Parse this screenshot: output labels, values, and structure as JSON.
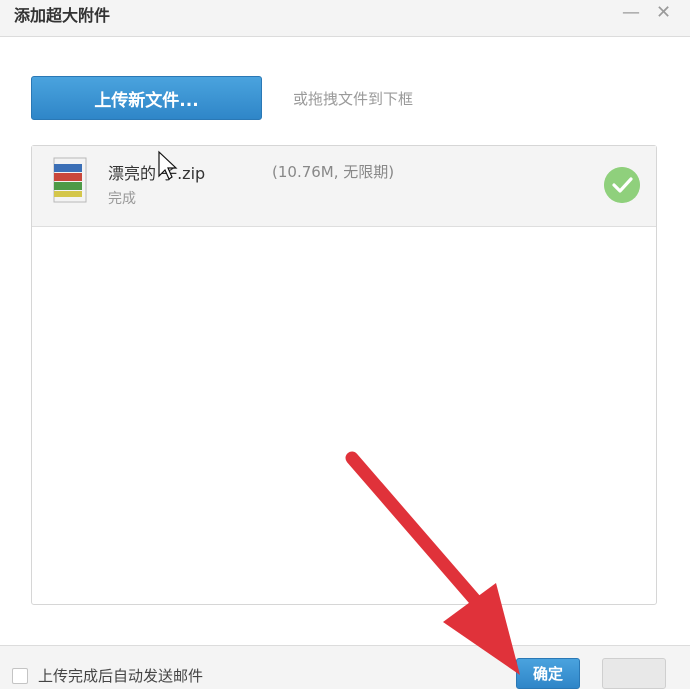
{
  "window": {
    "title": "添加超大附件",
    "minimize_icon": "minimize-icon",
    "close_icon": "close-icon"
  },
  "toolbar": {
    "upload_label": "上传新文件...",
    "drag_hint": "或拖拽文件到下框"
  },
  "file_list": {
    "items": [
      {
        "name": "漂亮的    子.zip",
        "meta": "(10.76M, 无限期)",
        "status": "完成",
        "icon": "archive-file-icon",
        "status_icon": "check-icon"
      }
    ]
  },
  "footer": {
    "auto_send_label": "上传完成后自动发送邮件",
    "auto_send_checked": false,
    "confirm_label": "确定",
    "cancel_label": ""
  },
  "colors": {
    "accent_blue": "#2f86c8",
    "success_green": "#8fd07c",
    "annotation_arrow_red": "#e0323a"
  }
}
